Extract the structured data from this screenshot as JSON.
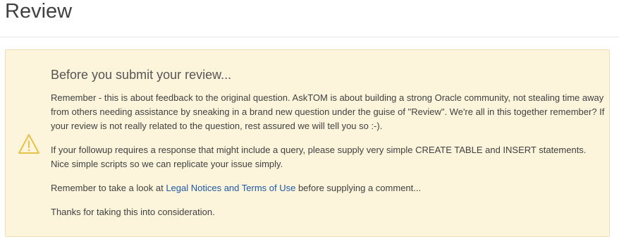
{
  "page": {
    "title": "Review"
  },
  "notice": {
    "icon": "warning-triangle-icon",
    "title": "Before you submit your review...",
    "paragraph1": "Remember - this is about feedback to the original question. AskTOM is about building a strong Oracle community, not stealing time away from others needing assistance by sneaking in a brand new question under the guise of \"Review\". We're all in this together remember? If your review is not really related to the question, rest assured we will tell you so :-).",
    "paragraph2": "If your followup requires a response that might include a query, please supply very simple CREATE TABLE and INSERT statements. Nice simple scripts so we can replicate your issue simply.",
    "paragraph3_prefix": "Remember to take a look at ",
    "paragraph3_link": "Legal Notices and Terms of Use",
    "paragraph3_suffix": " before supplying a comment...",
    "paragraph4": "Thanks for taking this into consideration."
  },
  "colors": {
    "alert_background": "#fcf5dc",
    "alert_border": "#ecdfb4",
    "warning_icon": "#e8c14a",
    "link": "#1c5aa6"
  }
}
